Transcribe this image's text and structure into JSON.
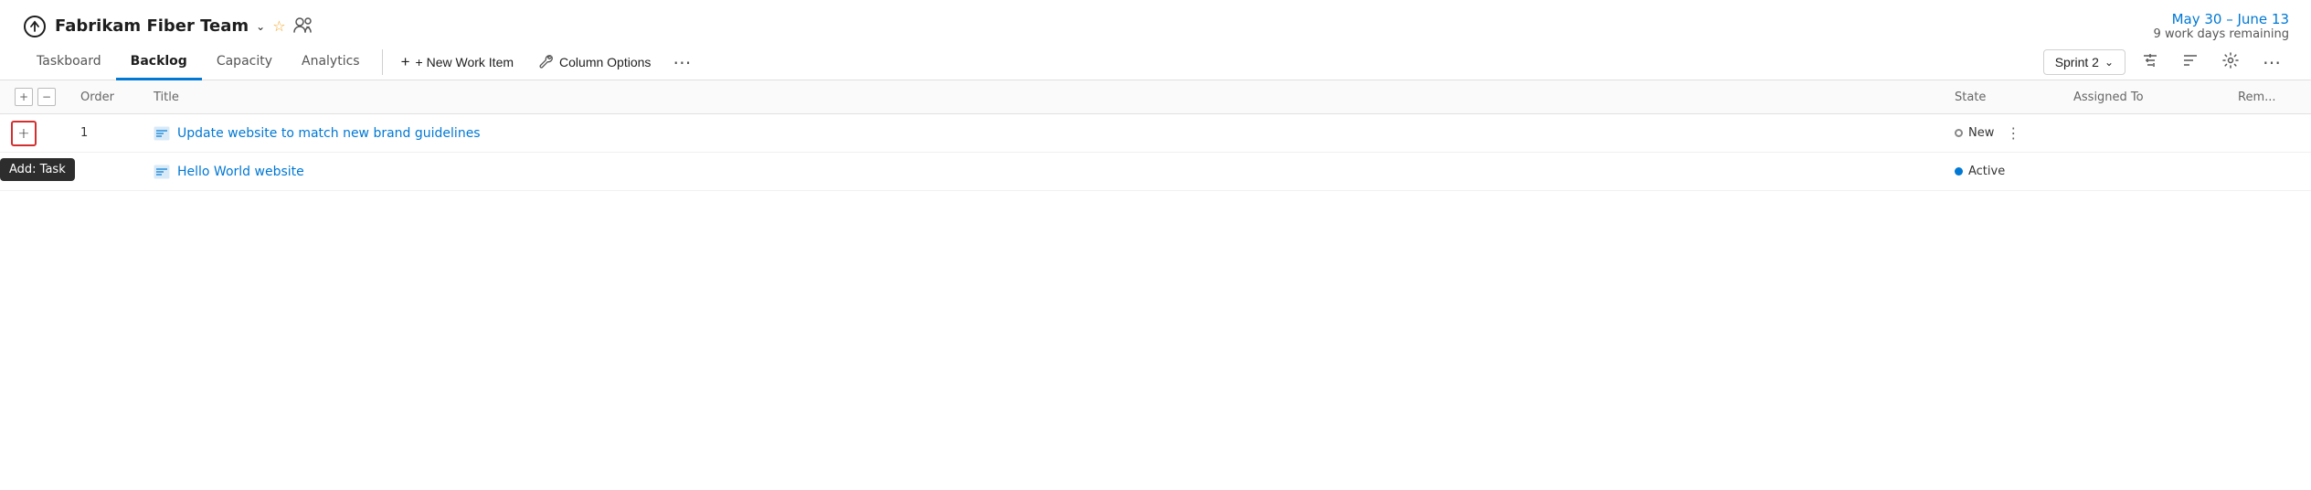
{
  "header": {
    "team_icon": "⏱",
    "team_name": "Fabrikam Fiber Team",
    "chevron": "∨",
    "star": "★",
    "people_icon": "⚇",
    "sprint_dates": "May 30 – June 13",
    "work_days": "9 work days remaining"
  },
  "nav": {
    "tabs": [
      {
        "id": "taskboard",
        "label": "Taskboard",
        "active": false
      },
      {
        "id": "backlog",
        "label": "Backlog",
        "active": true
      },
      {
        "id": "capacity",
        "label": "Capacity",
        "active": false
      },
      {
        "id": "analytics",
        "label": "Analytics",
        "active": false
      }
    ],
    "actions": {
      "new_work_item": "+ New Work Item",
      "column_options": "Column Options",
      "more": "⋯"
    },
    "right": {
      "sprint_label": "Sprint 2",
      "chevron": "∨",
      "filter_icon": "⇌",
      "sort_icon": "≡",
      "settings_icon": "⚙",
      "more": "⋯"
    }
  },
  "table": {
    "headers": {
      "order": "Order",
      "title": "Title",
      "state": "State",
      "assigned_to": "Assigned To",
      "remaining": "Rem..."
    },
    "rows": [
      {
        "order": "1",
        "title": "Update website to match new brand guidelines",
        "state": "New",
        "state_type": "new",
        "assigned_to": "",
        "remaining": ""
      },
      {
        "order": "",
        "title": "Hello World website",
        "state": "Active",
        "state_type": "active",
        "assigned_to": "",
        "remaining": ""
      }
    ],
    "add_task_tooltip": "Add: Task"
  }
}
